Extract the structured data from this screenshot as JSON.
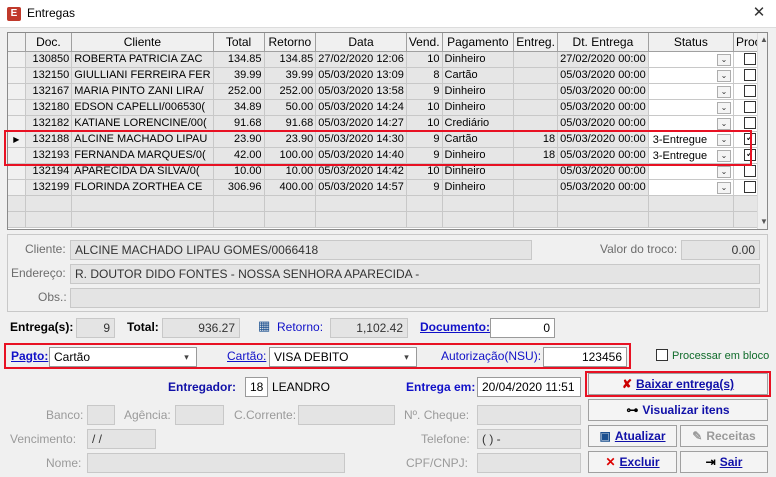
{
  "window": {
    "title": "Entregas",
    "close_glyph": "✕"
  },
  "grid": {
    "columns": [
      "Doc.",
      "Cliente",
      "Total",
      "Retorno",
      "Data",
      "Vend.",
      "Pagamento",
      "Entreg.",
      "Dt. Entrega",
      "Status",
      "Proc."
    ],
    "rows": [
      {
        "doc": "130850",
        "cliente": "ROBERTA PATRICIA ZAC",
        "total": "134.85",
        "retorno": "134.85",
        "data": "27/02/2020 12:06",
        "vend": "10",
        "pagamento": "Dinheiro",
        "entreg": "",
        "dt_entrega": "27/02/2020 00:00",
        "status": "",
        "proc": false
      },
      {
        "doc": "132150",
        "cliente": "GIULLIANI FERREIRA FER",
        "total": "39.99",
        "retorno": "39.99",
        "data": "05/03/2020 13:09",
        "vend": "8",
        "pagamento": "Cartão",
        "entreg": "",
        "dt_entrega": "05/03/2020 00:00",
        "status": "",
        "proc": false
      },
      {
        "doc": "132167",
        "cliente": "MARIA PINTO ZANI LIRA/",
        "total": "252.00",
        "retorno": "252.00",
        "data": "05/03/2020 13:58",
        "vend": "9",
        "pagamento": "Dinheiro",
        "entreg": "",
        "dt_entrega": "05/03/2020 00:00",
        "status": "",
        "proc": false
      },
      {
        "doc": "132180",
        "cliente": "EDSON CAPELLI/006530(",
        "total": "34.89",
        "retorno": "50.00",
        "data": "05/03/2020 14:24",
        "vend": "10",
        "pagamento": "Dinheiro",
        "entreg": "",
        "dt_entrega": "05/03/2020 00:00",
        "status": "",
        "proc": false
      },
      {
        "doc": "132182",
        "cliente": "KATIANE LORENCINE/00(",
        "total": "91.68",
        "retorno": "91.68",
        "data": "05/03/2020 14:27",
        "vend": "10",
        "pagamento": "Crediário",
        "entreg": "",
        "dt_entrega": "05/03/2020 00:00",
        "status": "",
        "proc": false
      },
      {
        "doc": "132188",
        "cliente": "ALCINE MACHADO LIPAU",
        "total": "23.90",
        "retorno": "23.90",
        "data": "05/03/2020 14:30",
        "vend": "9",
        "pagamento": "Cartão",
        "entreg": "18",
        "dt_entrega": "05/03/2020 00:00",
        "status": "3-Entregue",
        "proc": true
      },
      {
        "doc": "132193",
        "cliente": "FERNANDA MARQUES/0(",
        "total": "42.00",
        "retorno": "100.00",
        "data": "05/03/2020 14:40",
        "vend": "9",
        "pagamento": "Dinheiro",
        "entreg": "18",
        "dt_entrega": "05/03/2020 00:00",
        "status": "3-Entregue",
        "proc": true
      },
      {
        "doc": "132194",
        "cliente": "APARECIDA DA SILVA/0(",
        "total": "10.00",
        "retorno": "10.00",
        "data": "05/03/2020 14:42",
        "vend": "10",
        "pagamento": "Dinheiro",
        "entreg": "",
        "dt_entrega": "05/03/2020 00:00",
        "status": "",
        "proc": false
      },
      {
        "doc": "132199",
        "cliente": "FLORINDA ZORTHEA CE",
        "total": "306.96",
        "retorno": "400.00",
        "data": "05/03/2020 14:57",
        "vend": "9",
        "pagamento": "Dinheiro",
        "entreg": "",
        "dt_entrega": "05/03/2020 00:00",
        "status": "",
        "proc": false
      }
    ]
  },
  "details": {
    "cliente_label": "Cliente:",
    "cliente_value": "ALCINE MACHADO LIPAU GOMES/0066418",
    "valor_troco_label": "Valor do troco:",
    "valor_troco_value": "0.00",
    "endereco_label": "Endereço:",
    "endereco_value": "R. DOUTOR DIDO FONTES - NOSSA SENHORA APARECIDA -",
    "obs_label": "Obs.:",
    "obs_value": ""
  },
  "totals": {
    "entregas_label": "Entrega(s):",
    "entregas_value": "9",
    "total_label": "Total:",
    "total_value": "936.27",
    "retorno_label": "Retorno:",
    "retorno_value": "1,102.42",
    "documento_label": "Documento:",
    "documento_value": "0"
  },
  "payment": {
    "pagto_label": "Pagto:",
    "pagto_value": "Cartão",
    "cartao_label": "Cartão:",
    "cartao_value": "VISA DEBITO",
    "autorizacao_label": "Autorização(NSU):",
    "autorizacao_value": "123456",
    "processar_bloco_label": "Processar em bloco"
  },
  "delivery": {
    "entregador_label": "Entregador:",
    "entregador_code": "18",
    "entregador_name": "LEANDRO",
    "entrega_em_label": "Entrega em:",
    "entrega_em_value": "20/04/2020 11:51",
    "banco_label": "Banco:",
    "agencia_label": "Agência:",
    "ccorrente_label": "C.Corrente:",
    "cheque_label": "Nº. Cheque:",
    "vencimento_label": "Vencimento:",
    "vencimento_value": " / /",
    "telefone_label": "Telefone:",
    "telefone_value": "(  )  -",
    "nome_label": "Nome:",
    "cpf_label": "CPF/CNPJ:"
  },
  "buttons": {
    "baixar": "Baixar entrega(s)",
    "visualizar": "Visualizar itens",
    "atualizar": "Atualizar",
    "receitas": "Receitas",
    "excluir": "Excluir",
    "sair": "Sair"
  },
  "colors": {
    "highlight_border": "#e81123",
    "link_blue": "#1010c8",
    "grid_cell": "#e6e6e6"
  }
}
